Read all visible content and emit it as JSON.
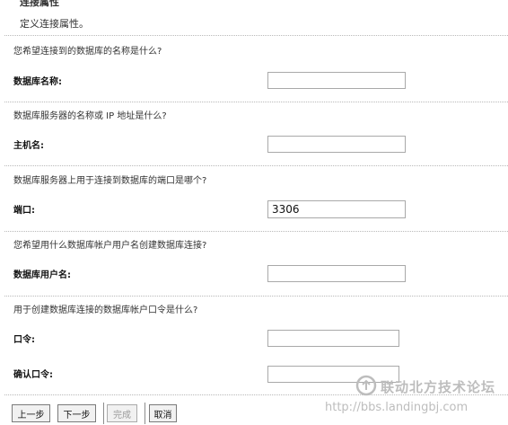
{
  "header": {
    "title": "连接属性",
    "description": "定义连接属性。"
  },
  "form": {
    "q_dbname": "您希望连接到的数据库的名称是什么?",
    "label_dbname": "数据库名称:",
    "value_dbname": "",
    "q_host": "数据库服务器的名称或 IP 地址是什么?",
    "label_host": "主机名:",
    "value_host": "",
    "q_port": "数据库服务器上用于连接到数据库的端口是哪个?",
    "label_port": "端口:",
    "value_port": "3306",
    "q_user": "您希望用什么数据库帐户用户名创建数据库连接?",
    "label_user": "数据库用户名:",
    "value_user": "",
    "q_password": "用于创建数据库连接的数据库帐户口令是什么?",
    "label_password": "口令:",
    "value_password": "",
    "label_confirm": "确认口令:",
    "value_confirm": ""
  },
  "buttons": {
    "prev": "上一步",
    "next": "下一步",
    "finish": "完成",
    "cancel": "取消"
  },
  "watermark": {
    "brand": "联动北方技术论坛",
    "url": "http://bbs.landingbj.com"
  }
}
